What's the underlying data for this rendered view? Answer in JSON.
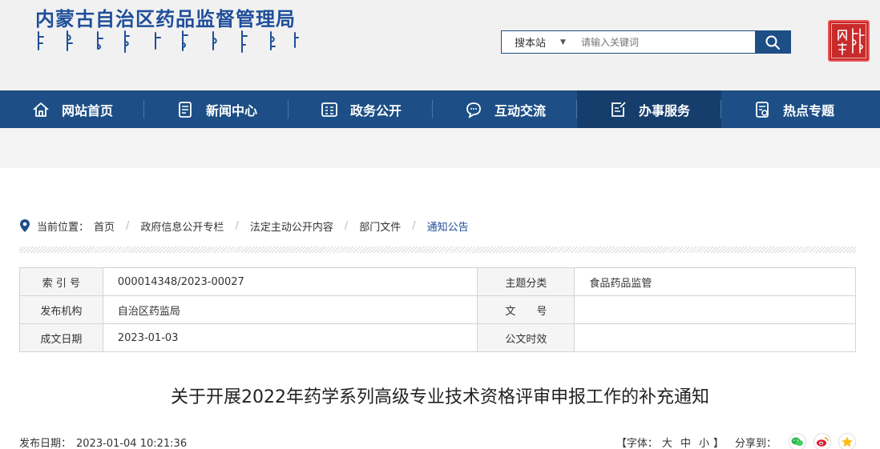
{
  "site": {
    "title": "内蒙古自治区药品监督管理局"
  },
  "search": {
    "scope": "搜本站",
    "placeholder": "请输入关键词"
  },
  "nav": {
    "items": [
      {
        "label": "网站首页",
        "icon": "home-icon"
      },
      {
        "label": "新闻中心",
        "icon": "news-icon"
      },
      {
        "label": "政务公开",
        "icon": "gov-info-icon"
      },
      {
        "label": "互动交流",
        "icon": "chat-icon"
      },
      {
        "label": "办事服务",
        "icon": "service-icon",
        "active": true
      },
      {
        "label": "热点专题",
        "icon": "topic-icon"
      }
    ]
  },
  "breadcrumb": {
    "prefix": "当前位置：",
    "items": [
      "首页",
      "政府信息公开专栏",
      "法定主动公开内容",
      "部门文件",
      "通知公告"
    ]
  },
  "meta": {
    "rows": [
      {
        "label1": "索 引 号",
        "value1": "000014348/2023-00027",
        "label2": "主题分类",
        "value2": "食品药品监管"
      },
      {
        "label1": "发布机构",
        "value1": "自治区药监局",
        "label2": "文　　号",
        "value2": ""
      },
      {
        "label1": "成文日期",
        "value1": "2023-01-03",
        "label2": "公文时效",
        "value2": ""
      }
    ]
  },
  "article": {
    "title": "关于开展2022年药学系列高级专业技术资格评审申报工作的补充通知",
    "pub_label": "发布日期：",
    "pub_date": "2023-01-04 10:21:36"
  },
  "tools": {
    "font_open": "【字体：",
    "font_big": "大",
    "font_mid": "中",
    "font_small": "小",
    "font_close": "】",
    "share_label": "分享到："
  },
  "colors": {
    "nav_bg": "#1d4f86",
    "nav_active": "#163e6c",
    "title_blue": "#1f4e9a",
    "seal_red": "#c92a2a"
  }
}
